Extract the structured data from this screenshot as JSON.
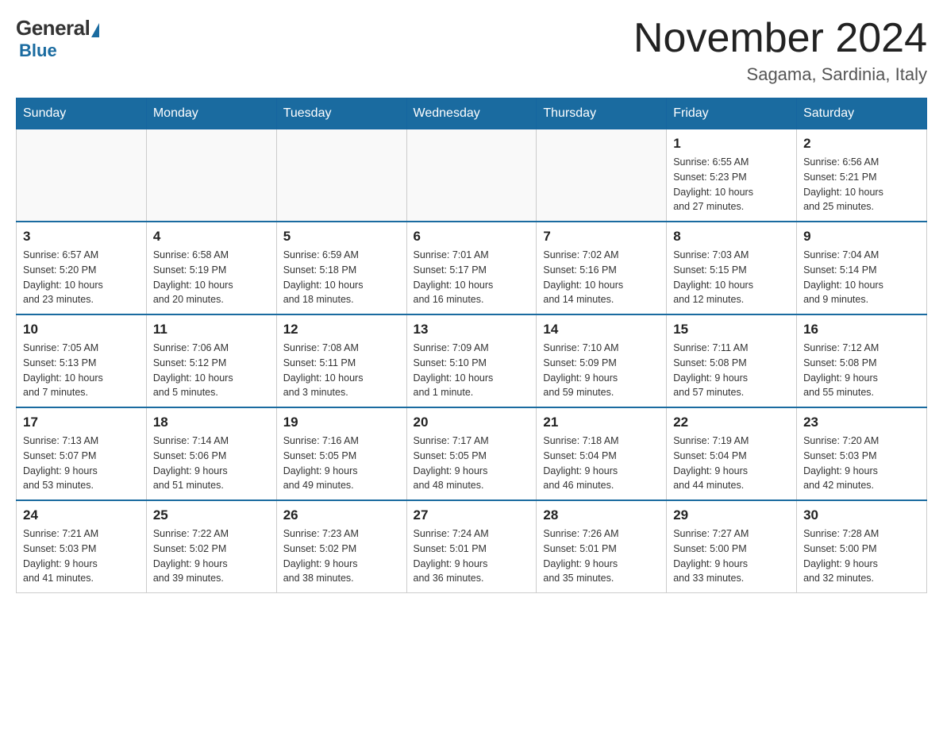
{
  "logo": {
    "general": "General",
    "blue": "Blue"
  },
  "title": "November 2024",
  "location": "Sagama, Sardinia, Italy",
  "days_of_week": [
    "Sunday",
    "Monday",
    "Tuesday",
    "Wednesday",
    "Thursday",
    "Friday",
    "Saturday"
  ],
  "weeks": [
    [
      {
        "day": "",
        "info": ""
      },
      {
        "day": "",
        "info": ""
      },
      {
        "day": "",
        "info": ""
      },
      {
        "day": "",
        "info": ""
      },
      {
        "day": "",
        "info": ""
      },
      {
        "day": "1",
        "info": "Sunrise: 6:55 AM\nSunset: 5:23 PM\nDaylight: 10 hours\nand 27 minutes."
      },
      {
        "day": "2",
        "info": "Sunrise: 6:56 AM\nSunset: 5:21 PM\nDaylight: 10 hours\nand 25 minutes."
      }
    ],
    [
      {
        "day": "3",
        "info": "Sunrise: 6:57 AM\nSunset: 5:20 PM\nDaylight: 10 hours\nand 23 minutes."
      },
      {
        "day": "4",
        "info": "Sunrise: 6:58 AM\nSunset: 5:19 PM\nDaylight: 10 hours\nand 20 minutes."
      },
      {
        "day": "5",
        "info": "Sunrise: 6:59 AM\nSunset: 5:18 PM\nDaylight: 10 hours\nand 18 minutes."
      },
      {
        "day": "6",
        "info": "Sunrise: 7:01 AM\nSunset: 5:17 PM\nDaylight: 10 hours\nand 16 minutes."
      },
      {
        "day": "7",
        "info": "Sunrise: 7:02 AM\nSunset: 5:16 PM\nDaylight: 10 hours\nand 14 minutes."
      },
      {
        "day": "8",
        "info": "Sunrise: 7:03 AM\nSunset: 5:15 PM\nDaylight: 10 hours\nand 12 minutes."
      },
      {
        "day": "9",
        "info": "Sunrise: 7:04 AM\nSunset: 5:14 PM\nDaylight: 10 hours\nand 9 minutes."
      }
    ],
    [
      {
        "day": "10",
        "info": "Sunrise: 7:05 AM\nSunset: 5:13 PM\nDaylight: 10 hours\nand 7 minutes."
      },
      {
        "day": "11",
        "info": "Sunrise: 7:06 AM\nSunset: 5:12 PM\nDaylight: 10 hours\nand 5 minutes."
      },
      {
        "day": "12",
        "info": "Sunrise: 7:08 AM\nSunset: 5:11 PM\nDaylight: 10 hours\nand 3 minutes."
      },
      {
        "day": "13",
        "info": "Sunrise: 7:09 AM\nSunset: 5:10 PM\nDaylight: 10 hours\nand 1 minute."
      },
      {
        "day": "14",
        "info": "Sunrise: 7:10 AM\nSunset: 5:09 PM\nDaylight: 9 hours\nand 59 minutes."
      },
      {
        "day": "15",
        "info": "Sunrise: 7:11 AM\nSunset: 5:08 PM\nDaylight: 9 hours\nand 57 minutes."
      },
      {
        "day": "16",
        "info": "Sunrise: 7:12 AM\nSunset: 5:08 PM\nDaylight: 9 hours\nand 55 minutes."
      }
    ],
    [
      {
        "day": "17",
        "info": "Sunrise: 7:13 AM\nSunset: 5:07 PM\nDaylight: 9 hours\nand 53 minutes."
      },
      {
        "day": "18",
        "info": "Sunrise: 7:14 AM\nSunset: 5:06 PM\nDaylight: 9 hours\nand 51 minutes."
      },
      {
        "day": "19",
        "info": "Sunrise: 7:16 AM\nSunset: 5:05 PM\nDaylight: 9 hours\nand 49 minutes."
      },
      {
        "day": "20",
        "info": "Sunrise: 7:17 AM\nSunset: 5:05 PM\nDaylight: 9 hours\nand 48 minutes."
      },
      {
        "day": "21",
        "info": "Sunrise: 7:18 AM\nSunset: 5:04 PM\nDaylight: 9 hours\nand 46 minutes."
      },
      {
        "day": "22",
        "info": "Sunrise: 7:19 AM\nSunset: 5:04 PM\nDaylight: 9 hours\nand 44 minutes."
      },
      {
        "day": "23",
        "info": "Sunrise: 7:20 AM\nSunset: 5:03 PM\nDaylight: 9 hours\nand 42 minutes."
      }
    ],
    [
      {
        "day": "24",
        "info": "Sunrise: 7:21 AM\nSunset: 5:03 PM\nDaylight: 9 hours\nand 41 minutes."
      },
      {
        "day": "25",
        "info": "Sunrise: 7:22 AM\nSunset: 5:02 PM\nDaylight: 9 hours\nand 39 minutes."
      },
      {
        "day": "26",
        "info": "Sunrise: 7:23 AM\nSunset: 5:02 PM\nDaylight: 9 hours\nand 38 minutes."
      },
      {
        "day": "27",
        "info": "Sunrise: 7:24 AM\nSunset: 5:01 PM\nDaylight: 9 hours\nand 36 minutes."
      },
      {
        "day": "28",
        "info": "Sunrise: 7:26 AM\nSunset: 5:01 PM\nDaylight: 9 hours\nand 35 minutes."
      },
      {
        "day": "29",
        "info": "Sunrise: 7:27 AM\nSunset: 5:00 PM\nDaylight: 9 hours\nand 33 minutes."
      },
      {
        "day": "30",
        "info": "Sunrise: 7:28 AM\nSunset: 5:00 PM\nDaylight: 9 hours\nand 32 minutes."
      }
    ]
  ]
}
